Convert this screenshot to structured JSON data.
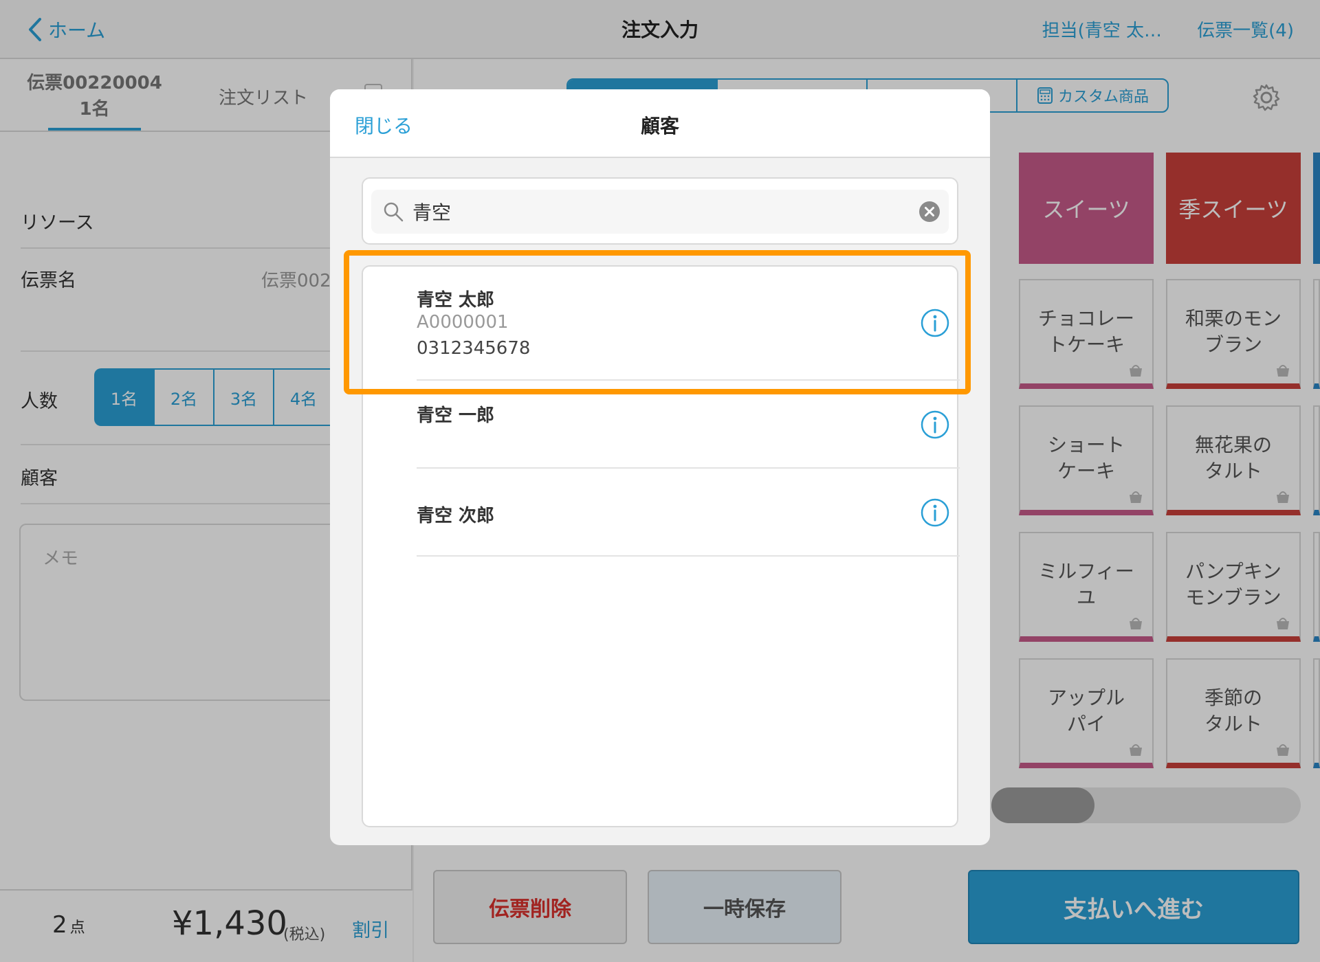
{
  "header": {
    "back_label": "ホーム",
    "title": "注文入力",
    "staff": "担当(青空 太…",
    "slip_list": "伝票一覧(4)"
  },
  "left": {
    "tab_slip_line1": "伝票00220004",
    "tab_slip_line2": "1名",
    "tab_order_list": "注文リスト",
    "resource_label": "リソース",
    "slip_name_label": "伝票名",
    "slip_name_value": "伝票002",
    "pax_label": "人数",
    "pax_options": [
      "1名",
      "2名",
      "3名",
      "4名"
    ],
    "customer_label": "顧客",
    "memo_placeholder": "メモ",
    "footer": {
      "count": "2",
      "count_unit": "点",
      "total": "¥1,430",
      "tax": "(税込)",
      "discount": "割引"
    }
  },
  "right": {
    "segments": [
      "",
      "",
      "",
      "カスタム商品"
    ],
    "categories": [
      {
        "label": "スイーツ",
        "color": "#c75b8a"
      },
      {
        "label": "季スイーツ",
        "color": "#c9403a"
      }
    ],
    "products": [
      [
        "チョコレー",
        "トケーキ"
      ],
      [
        "和栗のモン",
        "ブラン"
      ],
      [
        "ショート",
        "ケーキ"
      ],
      [
        "無花果の",
        "タルト"
      ],
      [
        "ミルフィー",
        "ユ"
      ],
      [
        "パンプキン",
        "モンブラン"
      ],
      [
        "アップル",
        "パイ"
      ],
      [
        "季節の",
        "タルト"
      ]
    ],
    "buttons": {
      "delete": "伝票削除",
      "temp_save": "一時保存",
      "pay": "支払いへ進む"
    }
  },
  "modal": {
    "close": "閉じる",
    "title": "顧客",
    "search_value": "青空",
    "customers": [
      {
        "name": "青空 太郎",
        "id": "A0000001",
        "phone": "0312345678"
      },
      {
        "name": "青空 一郎"
      },
      {
        "name": "青空 次郎"
      }
    ]
  },
  "colors": {
    "accent": "#2a9fd6",
    "highlight": "#ff9800",
    "danger": "#d9302c"
  }
}
